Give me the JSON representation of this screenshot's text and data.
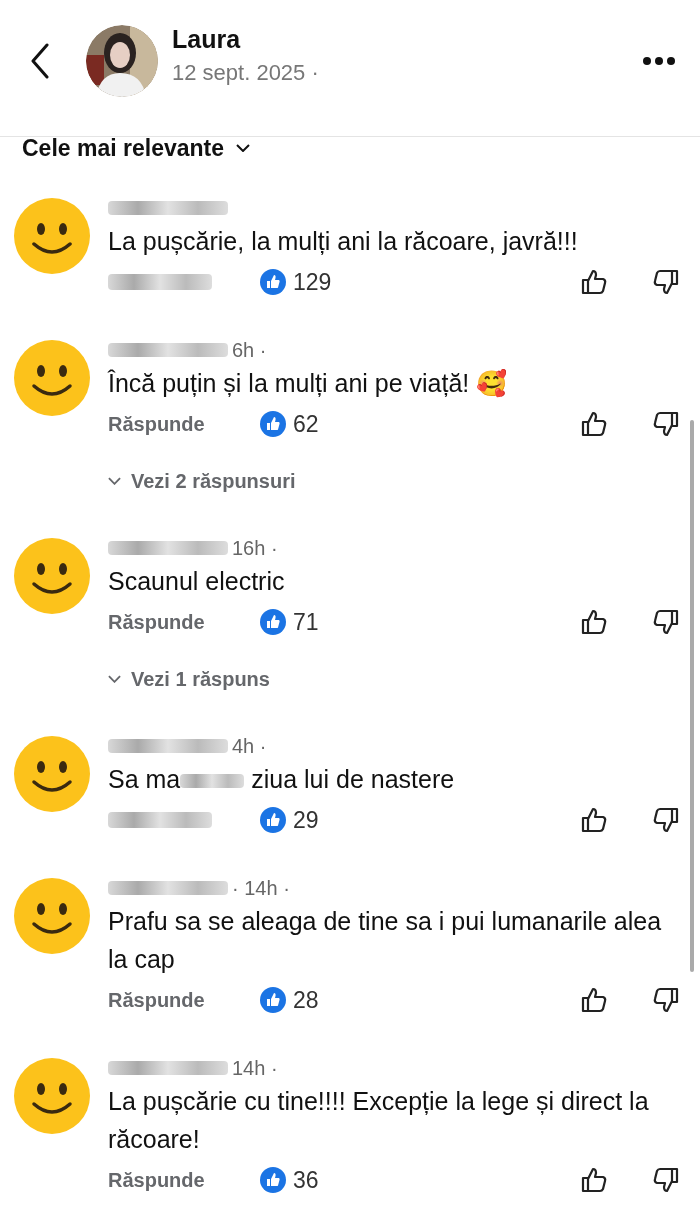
{
  "header": {
    "name": "Laura",
    "date": "12 sept. 2025 ·"
  },
  "sort": {
    "label": "Cele mai relevante"
  },
  "comments": [
    {
      "text": [
        "La pușcărie, la mulți ani la răcoare, javră!!!"
      ],
      "likes": "129"
    },
    {
      "time": "6h ·",
      "text": [
        "Încă puțin și la mulți ani pe viață! 🥰"
      ],
      "reply": "Răspunde",
      "likes": "62",
      "replies": "Vezi 2 răspunsuri"
    },
    {
      "time": "16h ·",
      "text": [
        "Scaunul electric"
      ],
      "reply": "Răspunde",
      "likes": "71",
      "replies": "Vezi 1 răspuns"
    },
    {
      "time": "4h ·",
      "text": [
        "Sa ma",
        "ziua lui de nastere"
      ],
      "likes": "29"
    },
    {
      "time": "· 14h ·",
      "text": [
        "Prafu sa se aleaga de tine sa i pui lumanarile alea la cap"
      ],
      "reply": "Răspunde",
      "likes": "28"
    },
    {
      "time": "14h ·",
      "text": [
        "La pușcărie cu tine!!!! Excepție la lege și direct la răcoare!"
      ],
      "reply": "Răspunde",
      "likes": "36"
    }
  ]
}
